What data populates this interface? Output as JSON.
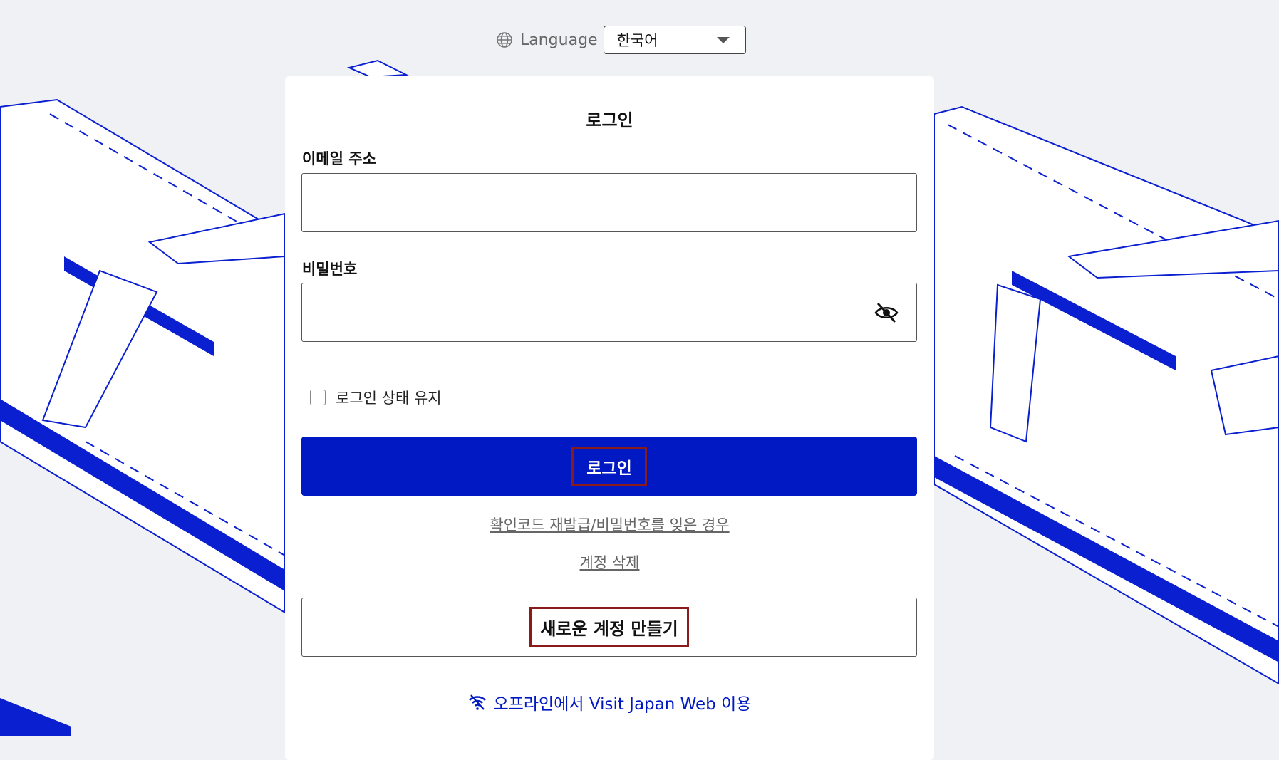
{
  "language": {
    "label": "Language",
    "selected": "한국어",
    "icon": "globe-icon"
  },
  "login_form": {
    "title": "로그인",
    "email_label": "이메일 주소",
    "email_value": "",
    "password_label": "비밀번호",
    "password_value": "",
    "password_toggle_icon": "eye-off-icon",
    "remember_label": "로그인 상태 유지",
    "remember_checked": false,
    "login_button": "로그인",
    "forgot_link": "확인코드 재발급/비밀번호를 잊은 경우",
    "delete_link": "계정 삭제",
    "create_button": "새로운 계정 만들기",
    "offline_link": "오프라인에서 Visit Japan Web 이용",
    "offline_icon": "wifi-off-icon"
  },
  "colors": {
    "brand_blue": "#0019c2",
    "background": "#f0f1f4",
    "highlight_border": "#8b1a1a"
  }
}
